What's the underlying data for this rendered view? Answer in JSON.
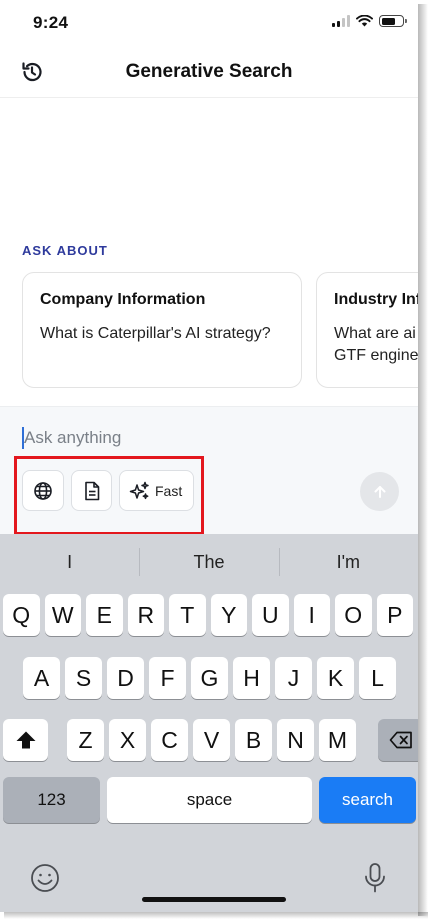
{
  "status_bar": {
    "time": "9:24"
  },
  "header": {
    "title": "Generative Search",
    "history_icon": "history-icon"
  },
  "ask_about": {
    "label": "ASK ABOUT"
  },
  "cards": [
    {
      "title": "Company Information",
      "text": "What is Caterpillar's AI strategy?"
    },
    {
      "title": "Industry Inf",
      "text": "What are ai GTF engine"
    }
  ],
  "composer": {
    "placeholder": "Ask anything",
    "tools": [
      {
        "icon": "globe-icon"
      },
      {
        "icon": "document-icon"
      },
      {
        "icon": "sparkles-icon",
        "label": "Fast"
      }
    ],
    "send_icon": "arrow-up-icon"
  },
  "keyboard": {
    "predictions": [
      "I",
      "The",
      "I'm"
    ],
    "row1": [
      "Q",
      "W",
      "E",
      "R",
      "T",
      "Y",
      "U",
      "I",
      "O",
      "P"
    ],
    "row2": [
      "A",
      "S",
      "D",
      "F",
      "G",
      "H",
      "J",
      "K",
      "L"
    ],
    "row3": [
      "Z",
      "X",
      "C",
      "V",
      "B",
      "N",
      "M"
    ],
    "numbers_label": "123",
    "space_label": "space",
    "search_label": "search"
  },
  "colors": {
    "accent_label": "#2e3a9c",
    "highlight_box": "#e3171e",
    "search_key": "#1a7cf5",
    "keyboard_bg": "#d1d4d9"
  }
}
